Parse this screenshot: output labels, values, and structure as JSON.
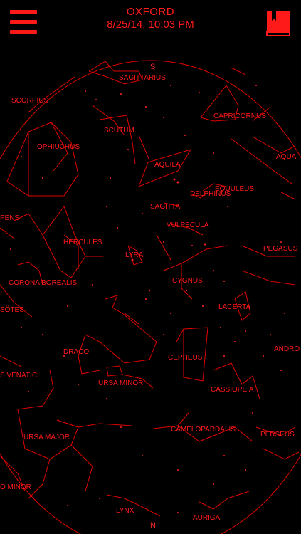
{
  "header": {
    "location": "OXFORD",
    "datetime": "8/25/14, 10:03 PM",
    "menu_icon": "hamburger-menu-icon",
    "book_icon": "book-icon"
  },
  "directions": {
    "top": "S",
    "bottom": "N"
  },
  "colors": {
    "accent": "#ff1a1a",
    "background": "#000000"
  },
  "constellations": [
    {
      "name": "SAGITTARIUS"
    },
    {
      "name": "SCORPIUS"
    },
    {
      "name": "CAPRICORNUS"
    },
    {
      "name": "SCUTUM"
    },
    {
      "name": "OPHIUCHUS"
    },
    {
      "name": "AQUA"
    },
    {
      "name": "AQUILA"
    },
    {
      "name": "EQUULEUS"
    },
    {
      "name": "DELPHINUS"
    },
    {
      "name": "PENS"
    },
    {
      "name": "SAGITTA"
    },
    {
      "name": "VULPECULA"
    },
    {
      "name": "HERCULES"
    },
    {
      "name": "PEGASUS"
    },
    {
      "name": "LYRA"
    },
    {
      "name": "CYGNUS"
    },
    {
      "name": "CORONA BOREALIS"
    },
    {
      "name": "LACERTA"
    },
    {
      "name": "SÖTES"
    },
    {
      "name": "ANDRO"
    },
    {
      "name": "DRACO"
    },
    {
      "name": "CEPHEUS"
    },
    {
      "name": "S VENATICI"
    },
    {
      "name": "URSA MINOR"
    },
    {
      "name": "CASSIOPEIA"
    },
    {
      "name": "CAMELOPARDALIS"
    },
    {
      "name": "URSA MAJOR"
    },
    {
      "name": "PERSEUS"
    },
    {
      "name": "O MINOR"
    },
    {
      "name": "LYNX"
    },
    {
      "name": "AURIGA"
    }
  ]
}
